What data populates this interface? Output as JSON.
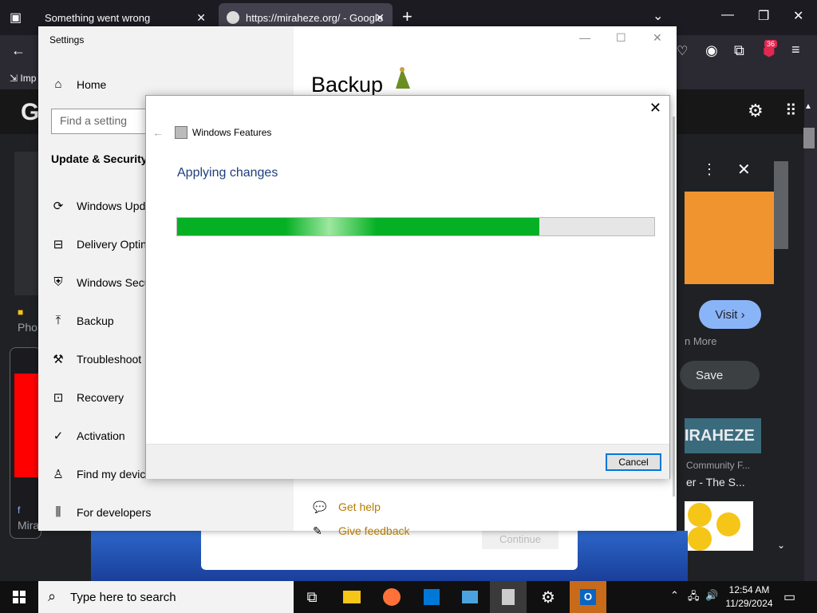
{
  "browser": {
    "tabs": [
      {
        "label": "Something went wrong"
      },
      {
        "label": "https://miraheze.org/ - Google"
      }
    ],
    "bookmark_label": "Imp",
    "badge_count": "36"
  },
  "google": {
    "logo": "G",
    "visit_label": "Visit",
    "learn_more": "n More",
    "save_label": "Save",
    "mira_logo": "IRAHEZE",
    "community_text": "Community F...",
    "ers_text": "er - The S...",
    "left_text_1": "Pho",
    "left_text_2": "Mira"
  },
  "settings": {
    "title": "Settings",
    "home": "Home",
    "find_placeholder": "Find a setting",
    "section": "Update & Security",
    "nav": [
      {
        "label": "Windows Upd"
      },
      {
        "label": "Delivery Optin"
      },
      {
        "label": "Windows Secu"
      },
      {
        "label": "Backup"
      },
      {
        "label": "Troubleshoot"
      },
      {
        "label": "Recovery"
      },
      {
        "label": "Activation"
      },
      {
        "label": "Find my device"
      },
      {
        "label": "For developers"
      }
    ],
    "page_title": "Backup",
    "get_help": "Get help",
    "give_feedback": "Give feedback",
    "continue_label": "Continue"
  },
  "dialog": {
    "title": "Windows Features",
    "heading": "Applying changes",
    "progress_percent": 76,
    "cancel_label": "Cancel"
  },
  "taskbar": {
    "search_placeholder": "Type here to search",
    "time": "12:54 AM",
    "date": "11/29/2024"
  }
}
